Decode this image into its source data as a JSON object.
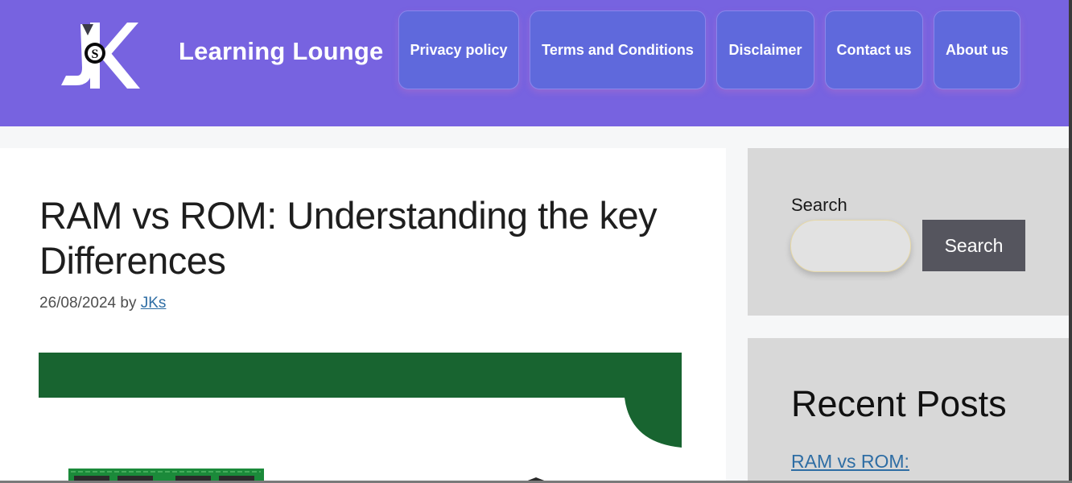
{
  "header": {
    "site_title": "Learning Lounge",
    "logo_text": "JSK",
    "bg_color": "#7763e0",
    "nav": [
      {
        "label": "Privacy policy"
      },
      {
        "label": "Terms and Conditions"
      },
      {
        "label": "Disclaimer"
      },
      {
        "label": "Contact us"
      },
      {
        "label": "About us"
      }
    ]
  },
  "post": {
    "title": "RAM vs ROM: Understanding the key Differences",
    "date": "26/08/2024",
    "by_label": "by",
    "author": "JKs",
    "featured_image": "RAM memory module illustration",
    "accent_color": "#186430"
  },
  "sidebar": {
    "search": {
      "label": "Search",
      "input_value": "",
      "placeholder": "",
      "button_label": "Search"
    },
    "recent_posts": {
      "title": "Recent Posts",
      "items": [
        {
          "label": "RAM vs ROM:"
        }
      ]
    }
  }
}
